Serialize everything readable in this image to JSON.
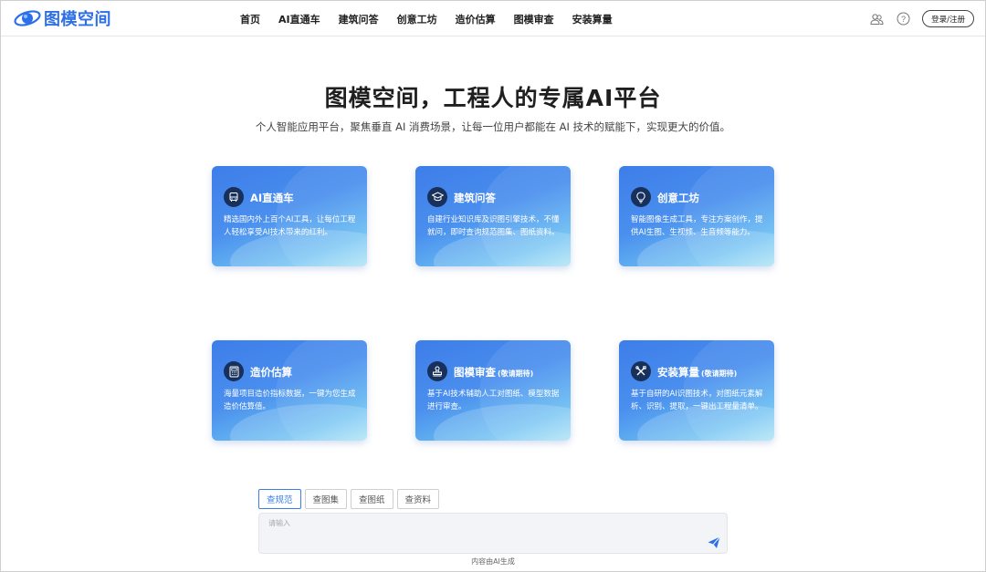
{
  "header": {
    "logo_text": "图模空间",
    "nav": [
      "首页",
      "AI直通车",
      "建筑问答",
      "创意工坊",
      "造价估算",
      "图模审查",
      "安装算量"
    ],
    "login_label": "登录/注册"
  },
  "hero": {
    "title": "图模空间，工程人的专属AI平台",
    "subtitle": "个人智能应用平台，聚焦垂直 AI 消费场景，让每一位用户都能在 AI 技术的赋能下，实现更大的价值。"
  },
  "cards": [
    {
      "title": "AI直通车",
      "tag": "",
      "desc": "精选国内外上百个AI工具，让每位工程人轻松享受AI技术带来的红利。",
      "icon": "bus-icon"
    },
    {
      "title": "建筑问答",
      "tag": "",
      "desc": "自建行业知识库及识图引擎技术，不懂就问，即时查询规范图集、图纸资料。",
      "icon": "graduation-cap-icon"
    },
    {
      "title": "创意工坊",
      "tag": "",
      "desc": "智能图像生成工具，专注方案创作，提供AI生图、生视频、生音频等能力。",
      "icon": "lightbulb-icon"
    },
    {
      "title": "造价估算",
      "tag": "",
      "desc": "海量项目造价指标数据，一键为您生成造价估算值。",
      "icon": "calculator-icon"
    },
    {
      "title": "图模审查",
      "tag": "(敬请期待)",
      "desc": "基于AI技术辅助人工对图纸、模型数据进行审查。",
      "icon": "stamp-icon"
    },
    {
      "title": "安装算量",
      "tag": "(敬请期待)",
      "desc": "基于自研的AI识图技术，对图纸元素解析、识别、提取，一键出工程量清单。",
      "icon": "tools-icon"
    }
  ],
  "search": {
    "tabs": [
      "查规范",
      "查图集",
      "查图纸",
      "查资料"
    ],
    "active_tab": "查规范",
    "placeholder": "请输入",
    "footnote": "内容由AI生成"
  },
  "colors": {
    "accent": "#2c6fe8",
    "card_start": "#3d7de9",
    "card_end": "#a8e2f6",
    "icon_bg": "#17315c"
  }
}
